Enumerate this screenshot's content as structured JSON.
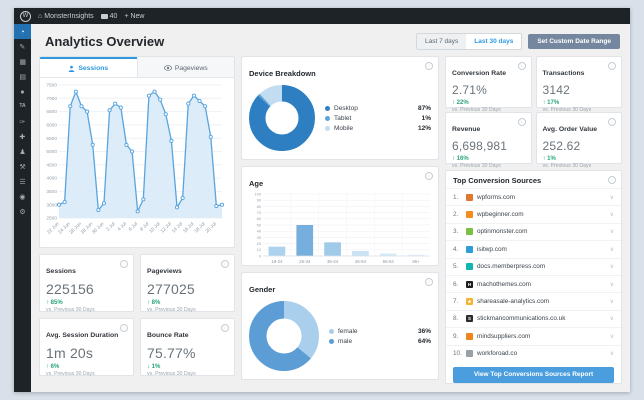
{
  "admin_bar": {
    "wp_badge": "W",
    "site_name": "MonsterInsights",
    "comments_count": "40",
    "new_label": "+ New"
  },
  "sidebar": {
    "items": [
      {
        "name": "insights-dashboard",
        "glyph": "◔",
        "active": true
      },
      {
        "name": "posts-pin",
        "glyph": "✎",
        "active": false
      },
      {
        "name": "media",
        "glyph": "▦",
        "active": false
      },
      {
        "name": "pages",
        "glyph": "▤",
        "active": false
      },
      {
        "name": "comments",
        "glyph": "●",
        "active": false
      },
      {
        "name": "ta-plugin",
        "glyph": "TA",
        "active": false,
        "text": true
      },
      {
        "name": "appearance",
        "glyph": "✑",
        "active": false
      },
      {
        "name": "plugins",
        "glyph": "✚",
        "active": false
      },
      {
        "name": "users",
        "glyph": "♟",
        "active": false
      },
      {
        "name": "tools",
        "glyph": "⚒",
        "active": false
      },
      {
        "name": "settings",
        "glyph": "☰",
        "active": false
      },
      {
        "name": "analytics-plugin",
        "glyph": "◉",
        "active": false
      },
      {
        "name": "collapse-gear",
        "glyph": "⚙",
        "active": false
      }
    ]
  },
  "page": {
    "title": "Analytics Overview"
  },
  "daterange": {
    "last7": "Last 7 days",
    "last30": "Last 30 days",
    "custom": "Set Custom Date Range",
    "selected": "Last 30 days"
  },
  "tabs": {
    "sessions": "Sessions",
    "pageviews": "Pageviews",
    "selected": "Sessions"
  },
  "cards": {
    "sessions": {
      "label": "Sessions",
      "value": "225156",
      "change": "↑ 85%",
      "compare": "vs. Previous 30 Days"
    },
    "pageviews": {
      "label": "Pageviews",
      "value": "277025",
      "change": "↑ 8%",
      "compare": "vs. Previous 30 Days"
    },
    "duration": {
      "label": "Avg. Session Duration",
      "value": "1m 20s",
      "change": "↑ 6%",
      "compare": "vs. Previous 30 Days"
    },
    "bounce": {
      "label": "Bounce Rate",
      "value": "75.77%",
      "change": "↓ 1%",
      "compare": "vs. Previous 30 Days"
    },
    "conversion": {
      "label": "Conversion Rate",
      "value": "2.71%",
      "change": "↑ 22%",
      "compare": "vs. Previous 30 Days"
    },
    "transactions": {
      "label": "Transactions",
      "value": "3142",
      "change": "↑ 17%",
      "compare": "vs. Previous 30 Days"
    },
    "revenue": {
      "label": "Revenue",
      "value": "6,698,981",
      "change": "↑ 16%",
      "compare": "vs. Previous 30 Days"
    },
    "aov": {
      "label": "Avg. Order Value",
      "value": "252.62",
      "change": "↑ 1%",
      "compare": "vs. Previous 30 Days"
    }
  },
  "sources": {
    "title": "Top Conversion Sources",
    "button": "View Top Conversions Sources Report",
    "items": [
      {
        "domain": "wpforms.com",
        "icon_color": "#e27730"
      },
      {
        "domain": "wpbeginner.com",
        "icon_color": "#f58a1f"
      },
      {
        "domain": "optinmonster.com",
        "icon_color": "#7ac043"
      },
      {
        "domain": "isitwp.com",
        "icon_color": "#2d9fd8"
      },
      {
        "domain": "docs.memberpress.com",
        "icon_color": "#0fb5ae"
      },
      {
        "domain": "machothemes.com",
        "icon_color": "#1e1e1e",
        "letter": "H"
      },
      {
        "domain": "shareasale-analytics.com",
        "icon_color": "#f5b335",
        "letter": "★"
      },
      {
        "domain": "stickmancommunications.co.uk",
        "icon_color": "#2b2b2b",
        "letter": "S"
      },
      {
        "domain": "mindsuppliers.com",
        "icon_color": "#f08519"
      },
      {
        "domain": "workforoad.co",
        "icon_color": "#98a0a8"
      }
    ]
  },
  "chart_data": [
    {
      "id": "sessions-trend",
      "type": "line",
      "title": "Sessions",
      "x": [
        "22 Jun",
        "24 Jun",
        "26 Jun",
        "28 Jun",
        "30 Jun",
        "2 Jul",
        "4 Jul",
        "6 Jul",
        "8 Jul",
        "10 Jul",
        "12 Jul",
        "14 Jul",
        "16 Jul",
        "18 Jul",
        "20 Jul"
      ],
      "values": [
        3000,
        3100,
        6700,
        7250,
        6700,
        6500,
        5250,
        2800,
        3050,
        6550,
        6800,
        6650,
        5250,
        5000,
        2750,
        3200,
        7100,
        7250,
        6950,
        6400,
        5400,
        2900,
        3250,
        6800,
        7100,
        6900,
        6700,
        5550,
        2950,
        3000
      ],
      "ylim": [
        2500,
        7500
      ],
      "yticks": [
        2500,
        3000,
        3500,
        4000,
        4500,
        5000,
        5500,
        6000,
        6500,
        7000,
        7500
      ],
      "line_color": "#58a4de",
      "fill_color": "#d7e9f8",
      "grid": true,
      "legend": "none"
    },
    {
      "id": "device-breakdown",
      "type": "pie",
      "title": "Device Breakdown",
      "labels": [
        "Desktop",
        "Tablet",
        "Mobile"
      ],
      "values": [
        87,
        1,
        12
      ],
      "colors": [
        "#2e7fc2",
        "#5ca4d8",
        "#c2ddf2"
      ],
      "legend": "right"
    },
    {
      "id": "age",
      "type": "bar",
      "title": "Age",
      "categories": [
        "18-24",
        "25-34",
        "35-44",
        "45-54",
        "55-64",
        "65+"
      ],
      "values": [
        15,
        50,
        22,
        8,
        4,
        2
      ],
      "colors": [
        "#add2ee",
        "#76aedd",
        "#9fcaea",
        "#c9e2f4",
        "#d5e9f7",
        "#e0eefa"
      ],
      "ylim": [
        0,
        100
      ],
      "yticks": [
        0,
        10,
        20,
        30,
        40,
        50,
        60,
        70,
        80,
        90,
        100
      ],
      "grid": true,
      "legend": "none"
    },
    {
      "id": "gender",
      "type": "pie",
      "title": "Gender",
      "labels": [
        "female",
        "male"
      ],
      "values": [
        36,
        64
      ],
      "colors": [
        "#a9cfec",
        "#5b9dd4"
      ],
      "legend": "right"
    }
  ]
}
